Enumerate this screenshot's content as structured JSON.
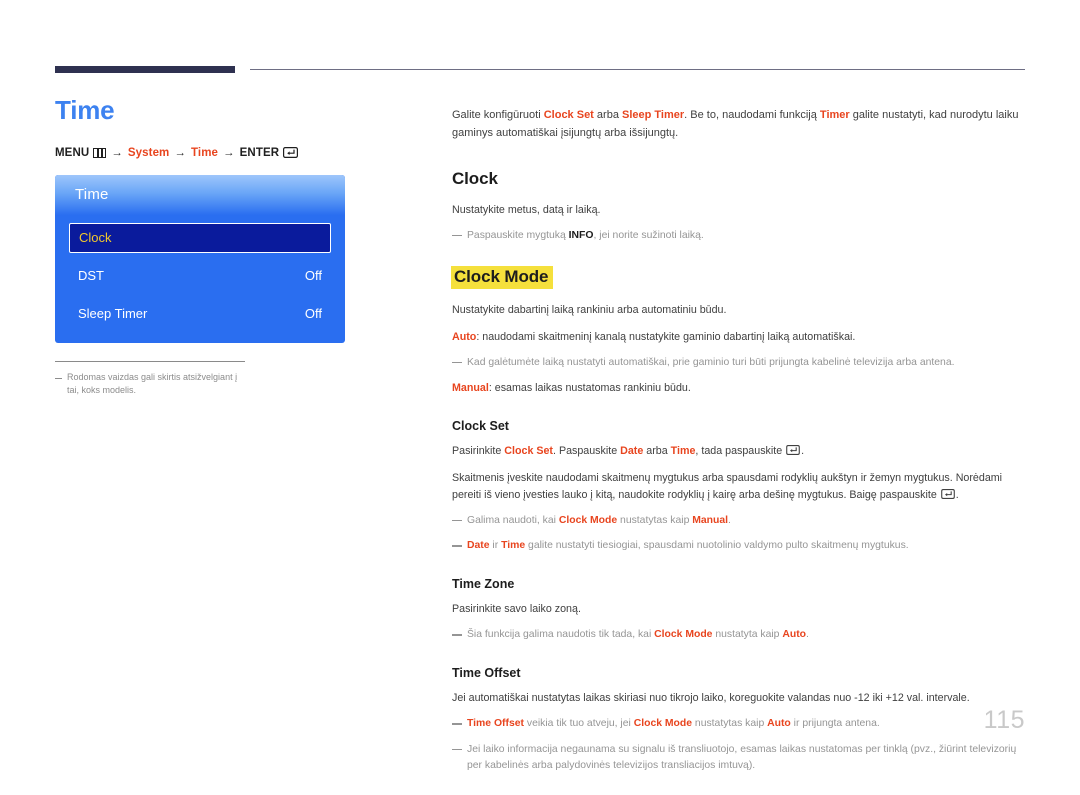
{
  "header": {
    "rule_thick_color": "#2e3150",
    "rule_thin_color": "#6e6e84"
  },
  "left": {
    "page_title": "Time",
    "breadcrumb": {
      "menu_label": "MENU",
      "menu_icon": "menu-grid-icon",
      "arrow": "→",
      "step_system": "System",
      "step_time": "Time",
      "enter_label": "ENTER",
      "enter_icon": "enter-return-icon"
    },
    "osd": {
      "title": "Time",
      "rows": [
        {
          "label": "Clock",
          "value": "",
          "selected": true
        },
        {
          "label": "DST",
          "value": "Off",
          "selected": false
        },
        {
          "label": "Sleep Timer",
          "value": "Off",
          "selected": false
        }
      ]
    },
    "footnote": "Rodomas vaizdas gali skirtis atsižvelgiant į tai, koks modelis."
  },
  "right": {
    "intro": {
      "a": "Galite konfigūruoti ",
      "b_accent": "Clock Set",
      "c": " arba ",
      "d_accent": "Sleep Timer",
      "e": ". Be to, naudodami funkciją ",
      "f_accent": "Timer",
      "g": " galite nustatyti, kad nurodytu laiku gaminys automatiškai įsijungtų arba išsijungtų."
    },
    "clock": {
      "heading": "Clock",
      "p1": "Nustatykite metus, datą ir laiką.",
      "note1_a": "Paspauskite mygtuką ",
      "note1_b_strong": "INFO",
      "note1_c": ", jei norite sužinoti laiką."
    },
    "clock_mode": {
      "heading": "Clock Mode",
      "highlight_color": "#f5e03c",
      "p1": "Nustatykite dabartinį laiką rankiniu arba automatiniu būdu.",
      "p2_accent": "Auto",
      "p2_rest": ": naudodami skaitmeninį kanalą nustatykite gaminio dabartinį laiką automatiškai.",
      "note1": "Kad galėtumėte laiką nustatyti automatiškai, prie gaminio turi būti prijungta kabelinė televizija arba antena.",
      "p3_accent": "Manual",
      "p3_rest": ": esamas laikas nustatomas rankiniu būdu."
    },
    "clock_set": {
      "heading": "Clock Set",
      "p1_a": "Pasirinkite ",
      "p1_b_accent": "Clock Set",
      "p1_c": ". Paspauskite ",
      "p1_d_accent": "Date",
      "p1_e": " arba ",
      "p1_f_accent": "Time",
      "p1_g": ", tada paspauskite ",
      "p1_h": ".",
      "p2_a": "Skaitmenis įveskite naudodami skaitmenų mygtukus arba spausdami rodyklių aukštyn ir žemyn mygtukus. Norėdami pereiti iš vieno įvesties lauko į kitą, naudokite rodyklių į kairę arba dešinę mygtukus. Baigę paspauskite ",
      "p2_b": ".",
      "note1_a": "Galima naudoti, kai ",
      "note1_b_accent": "Clock Mode",
      "note1_c": " nustatytas kaip ",
      "note1_d_accent": "Manual",
      "note1_e": ".",
      "note2_a_accent": "Date",
      "note2_b": " ir ",
      "note2_c_accent": "Time",
      "note2_d": " galite nustatyti tiesiogiai, spausdami nuotolinio valdymo pulto skaitmenų mygtukus."
    },
    "time_zone": {
      "heading": "Time Zone",
      "p1": "Pasirinkite savo laiko zoną.",
      "note1_a": "Šia funkcija galima naudotis tik tada, kai ",
      "note1_b_accent": "Clock Mode",
      "note1_c": " nustatyta kaip ",
      "note1_d_accent": "Auto",
      "note1_e": "."
    },
    "time_offset": {
      "heading": "Time Offset",
      "p1": "Jei automatiškai nustatytas laikas skiriasi nuo tikrojo laiko, koreguokite valandas nuo -12 iki +12 val. intervale.",
      "note1_a_accent": "Time Offset",
      "note1_b": " veikia tik tuo atveju, jei ",
      "note1_c_accent": "Clock Mode",
      "note1_d": " nustatytas kaip ",
      "note1_e_accent": "Auto",
      "note1_f": " ir prijungta antena.",
      "note2": "Jei laiko informacija negaunama su signalu iš transliuotojo, esamas laikas nustatomas per tinklą (pvz., žiūrint televizorių per kabelinės arba palydovinės televizijos transliacijos imtuvą)."
    }
  },
  "page_number": "115"
}
